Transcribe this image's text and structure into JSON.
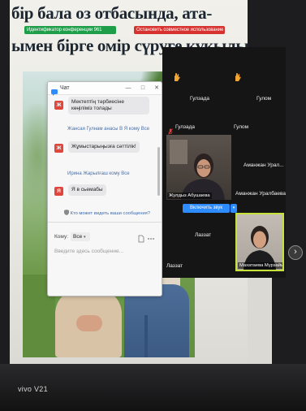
{
  "slide": {
    "line1": "бір бала оз отбасында, ата-",
    "line2": "ымен бірге омір сүруге құқылы"
  },
  "share_toolbar": {
    "status": "Идентификатор конференции 961",
    "stop_label": "Остановить совместное использование"
  },
  "chat": {
    "title": "Чат",
    "messages": [
      {
        "avatar": "Ж",
        "text": "Мектептің тәрбиесіне көңіліміз толады"
      },
      {
        "header": "Жансая Гулнам анасы В Я кому Все",
        "avatar": "Ж",
        "text": "Жұмыстарыңызға сәттілік!"
      },
      {
        "header": "Ирина Жарылғаш кому Все",
        "avatar": "Я",
        "text": "Я в сьемабы"
      }
    ],
    "privacy_note": "Кто может видеть ваши сообщения?",
    "to_label": "Кому:",
    "to_value": "Все",
    "placeholder": "Введите здесь сообщение..."
  },
  "participants": {
    "row1": [
      {
        "name": "Гулзада",
        "hand_raised": true
      },
      {
        "name": "Гулом",
        "hand_raised": true
      }
    ],
    "row2": [
      {
        "name": "Гулзада",
        "muted": true
      },
      {
        "name": "Гулом"
      }
    ],
    "video_left_name": "Жулдыз Абушаева",
    "right_text": "Аманжан Урал...",
    "right_name": "Аманжан Уралбаева",
    "unmute_label": "Включить звук",
    "center_name": "Лаззат",
    "bottom_left_name": "Лаззат",
    "active_speaker_name": "Махатаева Мурзайым"
  },
  "watermark": "vivo V21",
  "icons": [
    "chat-icon",
    "minimize-icon",
    "maximize-icon",
    "close-icon",
    "shield-icon",
    "chevron-down-icon",
    "file-icon",
    "more-icon",
    "raised-hand-icon",
    "muted-mic-icon",
    "chevron-right-icon"
  ],
  "colors": {
    "share_green": "#1f9e4a",
    "stop_red": "#d6322f",
    "avatar_red": "#e0463c",
    "unmute_blue": "#2d8cff",
    "active_speaker": "#c6e23a",
    "hand": "#f2a531"
  }
}
